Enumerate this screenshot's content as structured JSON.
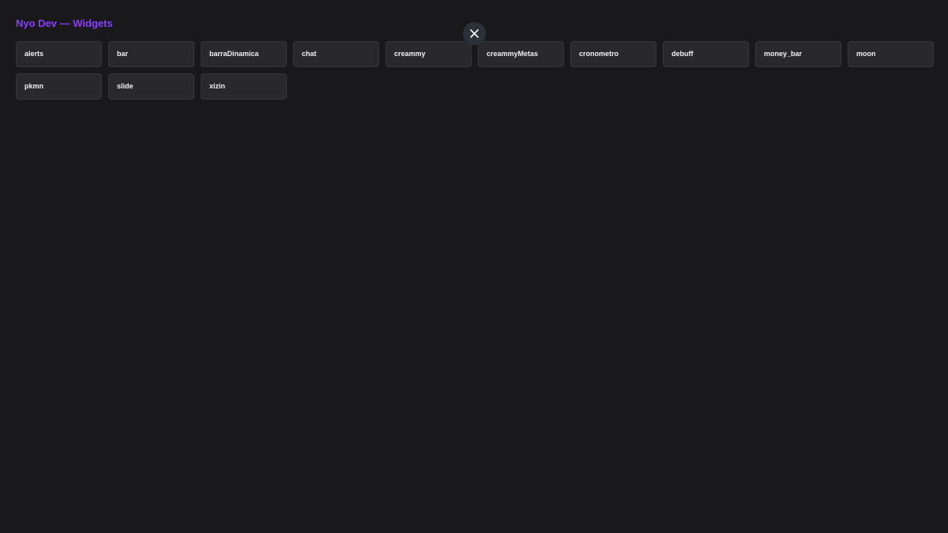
{
  "header": {
    "title": "Nyo Dev — Widgets"
  },
  "close_button": {
    "icon": "close-icon"
  },
  "widgets": [
    {
      "label": "alerts"
    },
    {
      "label": "bar"
    },
    {
      "label": "barraDinamica"
    },
    {
      "label": "chat"
    },
    {
      "label": "creammy"
    },
    {
      "label": "creammyMetas"
    },
    {
      "label": "cronometro"
    },
    {
      "label": "debuff"
    },
    {
      "label": "money_bar"
    },
    {
      "label": "moon"
    },
    {
      "label": "pkmn"
    },
    {
      "label": "slide"
    },
    {
      "label": "xizin"
    }
  ],
  "colors": {
    "background": "#19191b",
    "accent": "#8b3dff",
    "card": "#29292c",
    "card_border": "#37373b",
    "text": "#f2f2f2"
  }
}
